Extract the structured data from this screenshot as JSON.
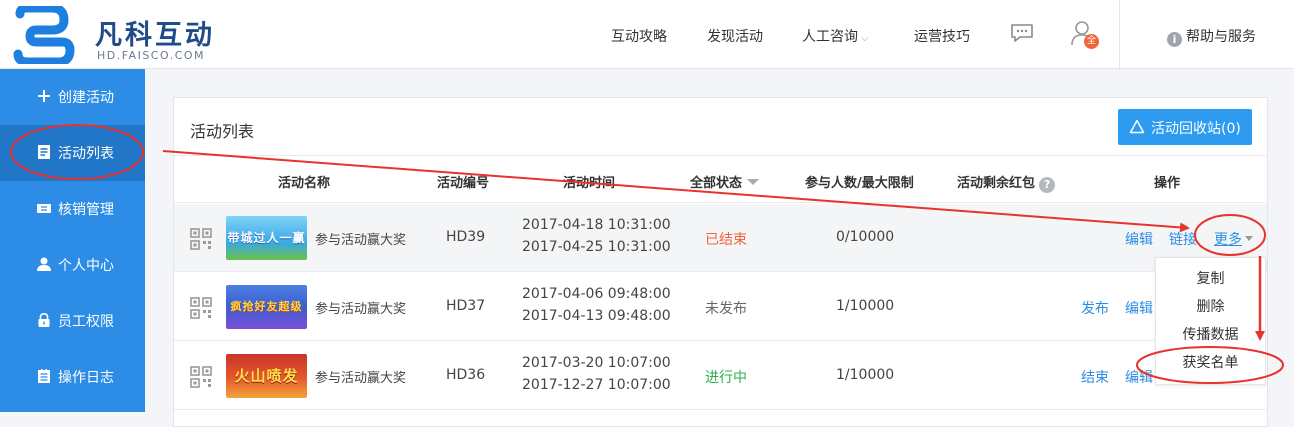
{
  "header": {
    "logo_text": "凡科互动",
    "logo_sub": "HD.FAISCO.COM",
    "nav": [
      "互动攻略",
      "发现活动",
      "人工咨询",
      "运营技巧"
    ],
    "avatar_badge": "全",
    "help_label": "帮助与服务",
    "help_icon_text": "i"
  },
  "sidebar": {
    "items": [
      {
        "label": "创建活动",
        "icon": "plus-icon"
      },
      {
        "label": "活动列表",
        "icon": "list-icon"
      },
      {
        "label": "核销管理",
        "icon": "ticket-icon"
      },
      {
        "label": "个人中心",
        "icon": "user-icon"
      },
      {
        "label": "员工权限",
        "icon": "lock-icon"
      },
      {
        "label": "操作日志",
        "icon": "log-icon"
      }
    ]
  },
  "main": {
    "title": "活动列表",
    "recycle_label": "活动回收站(0)",
    "columns": {
      "name": "活动名称",
      "code": "活动编号",
      "time": "活动时间",
      "status": "全部状态",
      "count": "参与人数/最大限制",
      "redpack": "活动剩余红包",
      "redpack_help": "?",
      "ops": "操作"
    },
    "rows": [
      {
        "thumb_text": "带城过人一赢好礼",
        "name": "参与活动赢大奖",
        "code": "HD39",
        "start": "2017-04-18 10:31:00",
        "end": "2017-04-25 10:31:00",
        "status": "已结束",
        "status_color": "#f0643c",
        "count": "0/10000",
        "ops": [
          "编辑",
          "链接",
          "更多"
        ]
      },
      {
        "thumb_text": "疯抢好友超级召唤",
        "name": "参与活动赢大奖",
        "code": "HD37",
        "start": "2017-04-06 09:48:00",
        "end": "2017-04-13 09:48:00",
        "status": "未发布",
        "status_color": "#666666",
        "count": "1/10000",
        "ops": [
          "发布",
          "编辑"
        ]
      },
      {
        "thumb_text": "火山喷发",
        "name": "参与活动赢大奖",
        "code": "HD36",
        "start": "2017-03-20 10:07:00",
        "end": "2017-12-27 10:07:00",
        "status": "进行中",
        "status_color": "#2bb24c",
        "count": "1/10000",
        "ops": [
          "结束",
          "编辑"
        ]
      }
    ],
    "more_menu": [
      "复制",
      "删除",
      "传播数据",
      "获奖名单"
    ]
  },
  "colors": {
    "sidebar": "#2d8de6",
    "sidebar_active": "#2276c8",
    "accent": "#2d9cf0",
    "annotation": "#e8322e"
  }
}
